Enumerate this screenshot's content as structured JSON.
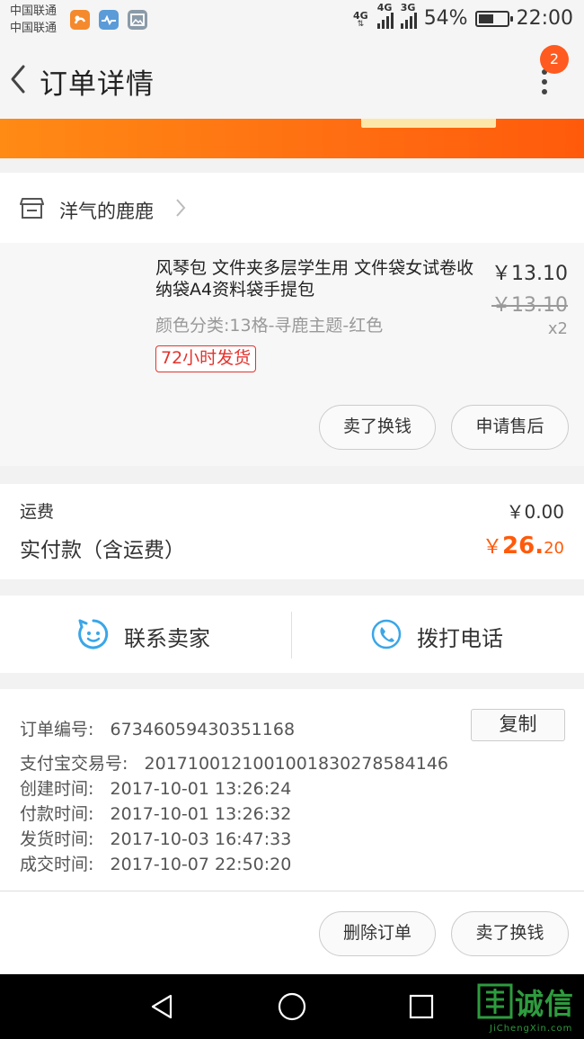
{
  "status_bar": {
    "carrier_1": "中国联通",
    "carrier_2": "中国联通",
    "network_1": "4G",
    "network_2": "4G",
    "network_3": "3G",
    "battery": "54%",
    "time": "22:00",
    "icons": [
      "uc-browser-icon",
      "health-app-icon",
      "gallery-icon"
    ]
  },
  "header": {
    "title": "订单详情",
    "badge_count": "2"
  },
  "shop": {
    "name": "洋气的鹿鹿"
  },
  "item": {
    "title": "风琴包 文件夹多层学生用 文件袋女试卷收纳袋A4资料袋手提包",
    "price": "￥13.10",
    "original_price": "￥13.10",
    "quantity": "x2",
    "sku": "颜色分类:13格-寻鹿主题-红色",
    "tag": "72小时发货",
    "sell_button": "卖了换钱",
    "aftersale_button": "申请售后"
  },
  "fees": {
    "shipping_label": "运费",
    "shipping_value": "￥0.00",
    "paid_label": "实付款（含运费）",
    "paid_currency": "￥",
    "paid_integer": "26.",
    "paid_decimal": "20"
  },
  "contact": {
    "seller_label": "联系卖家",
    "phone_label": "拨打电话"
  },
  "order_info": {
    "order_no_label": "订单编号:",
    "order_no": "67346059430351168",
    "copy_button": "复制",
    "alipay_label": "支付宝交易号:",
    "alipay_no": "2017100121001001830278584146",
    "created_label": "创建时间:",
    "created_time": "2017-10-01 13:26:24",
    "paid_label": "付款时间:",
    "paid_time": "2017-10-01 13:26:32",
    "shipped_label": "发货时间:",
    "shipped_time": "2017-10-03 16:47:33",
    "completed_label": "成交时间:",
    "completed_time": "2017-10-07 22:50:20"
  },
  "actions": {
    "delete_button": "删除订单",
    "sell_button": "卖了换钱"
  },
  "watermark": {
    "text": "诚信",
    "sub": "JiChengXin.com"
  },
  "colors": {
    "accent": "#ff5a0a",
    "tag_red": "#e3332d",
    "icon_blue": "#3aa6e8"
  }
}
